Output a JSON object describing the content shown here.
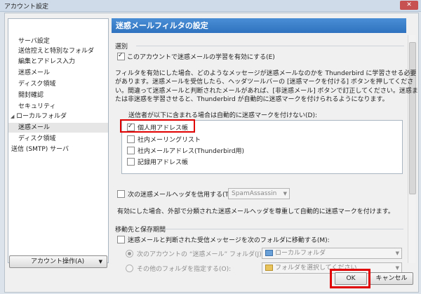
{
  "window": {
    "title": "アカウント設定",
    "close_label": "✕"
  },
  "tree": {
    "items": [
      {
        "label": "サーバ設定",
        "indent": 1
      },
      {
        "label": "送信控えと特別なフォルダ",
        "indent": 1
      },
      {
        "label": "編集とアドレス入力",
        "indent": 1
      },
      {
        "label": "迷惑メール",
        "indent": 1
      },
      {
        "label": "ディスク領域",
        "indent": 1
      },
      {
        "label": "開封確認",
        "indent": 1
      },
      {
        "label": "セキュリティ",
        "indent": 1
      },
      {
        "label": "ローカルフォルダ",
        "indent": 0,
        "twisty": "◢"
      },
      {
        "label": "迷惑メール",
        "indent": 1,
        "selected": true
      },
      {
        "label": "ディスク領域",
        "indent": 1
      },
      {
        "label": "送信 (SMTP) サーバ",
        "indent": 0
      }
    ]
  },
  "account_actions": {
    "label": "アカウント操作(A)",
    "arrow": "▼"
  },
  "header": {
    "title": "迷惑メールフィルタの設定"
  },
  "selection": {
    "section_label": "選別",
    "enable_label": "このアカウントで迷惑メールの学習を有効にする(E)",
    "enable_checked": true,
    "description": [
      "フィルタを有効にした場合、どのようなメッセージが迷惑メールなのかを Thunderbird に学習させる必要",
      "があります。迷惑メールを受信したら、ヘッダツールバーの [迷惑マークを付ける] ボタンを押してくださ",
      "い。間違って迷惑メールと判断されたメールがあれば、[非迷惑メール] ボタンで訂正してください。迷惑ま",
      "たは非迷惑を学習させると、Thunderbird が自動的に迷惑マークを付けられるようになります。"
    ],
    "whitelist_label": "送信者が以下に含まれる場合は自動的に迷惑マークを付けない(D):",
    "address_books": [
      {
        "label": "個人用アドレス帳",
        "checked": true
      },
      {
        "label": "社内メーリングリスト",
        "checked": false
      },
      {
        "label": "社内メールアドレス(Thunderbird用)",
        "checked": false
      },
      {
        "label": "記録用アドレス帳",
        "checked": false
      }
    ],
    "trust_header_label": "次の迷惑メールヘッダを信用する(T):",
    "trust_header_value": "SpamAssassin",
    "trust_header_note": "有効にした場合、外部で分類された迷惑メールヘッダを尊重して自動的に迷惑マークを付けます。"
  },
  "destination": {
    "section_label": "移動先と保存期間",
    "move_label": "迷惑メールと判断された受信メッセージを次のフォルダに移動する(M):",
    "radio_account_label": "次のアカウントの “迷惑メール” フォルダ(J):",
    "radio_account_value": "ローカルフォルダ",
    "radio_other_label": "その他のフォルダを指定する(O):",
    "radio_other_value": "フォルダを選択してください"
  },
  "buttons": {
    "ok": "OK",
    "cancel": "キャンセル"
  },
  "colors": {
    "header": "#3a7fcc",
    "highlight": "#e00000"
  }
}
